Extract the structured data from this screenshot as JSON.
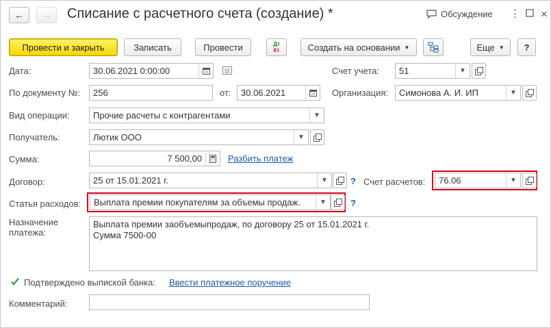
{
  "header": {
    "title": "Списание с расчетного счета (создание) *",
    "discussion_label": "Обсуждение"
  },
  "toolbar": {
    "post_close": "Провести и закрыть",
    "save": "Записать",
    "post": "Провести",
    "dt_kt_top": "Дт",
    "dt_kt_bottom": "Кт",
    "create_based": "Создать на основании",
    "more": "Еще",
    "help": "?"
  },
  "form": {
    "date_label": "Дата:",
    "date_value": "30.06.2021  0:00:00",
    "account_label": "Счет учета:",
    "account_value": "51",
    "doc_number_label": "По документу №:",
    "doc_number_value": "256",
    "from_label": "от:",
    "from_value": "30.06.2021",
    "org_label": "Организация:",
    "org_value": "Симонова А. И. ИП",
    "op_type_label": "Вид операции:",
    "op_type_value": "Прочие расчеты с контрагентами",
    "recipient_label": "Получатель:",
    "recipient_value": "Лютик ООО",
    "sum_label": "Сумма:",
    "sum_value": "7 500,00",
    "split_payment_link": "Разбить платеж",
    "contract_label": "Договор:",
    "contract_value": "25 от 15.01.2021 г.",
    "settlement_label": "Счет расчетов:",
    "settlement_value": "76.06",
    "expense_label": "Статья расходов:",
    "expense_value": "Выплата премии покупателям за объемы продаж.",
    "purpose_label_1": "Назначение",
    "purpose_label_2": "платежа:",
    "purpose_line_1": "Выплата премии заобъемыпродаж, по договору 25 от 15.01.2021 г.",
    "purpose_line_2": "Сумма 7500-00",
    "confirmed_label": "Подтверждено выпиской банка:",
    "confirmed_checked": true,
    "enter_order_link": "Ввести платежное поручение",
    "comment_label": "Комментарий:",
    "comment_value": "",
    "help_q": "?"
  },
  "colors": {
    "primary_button": "#f5d800",
    "highlight_border": "#d6001c",
    "link": "#1c5aa6",
    "checkbox_check": "#2e9b3a"
  }
}
